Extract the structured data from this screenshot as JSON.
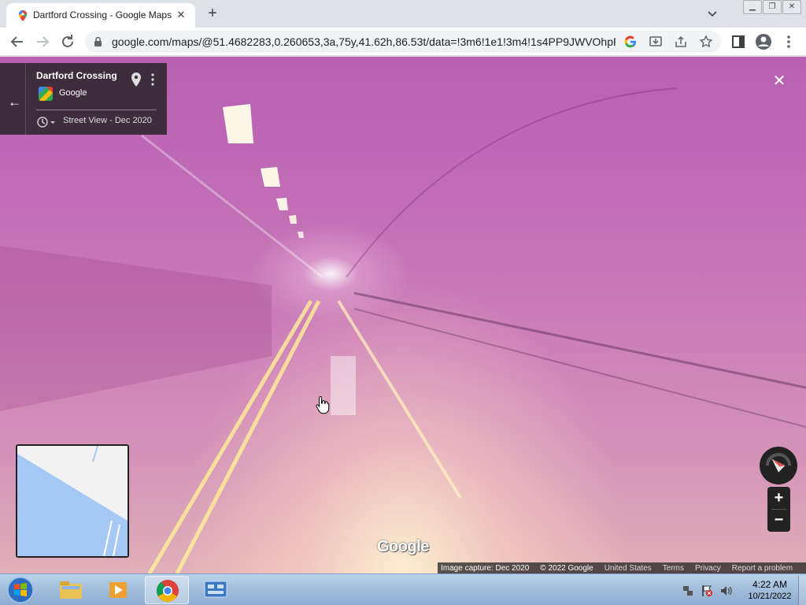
{
  "browser": {
    "tab": {
      "title": "Dartford Crossing - Google Maps",
      "favicon": "google-maps-pin-icon",
      "close_label": "✕"
    },
    "new_tab_label": "+",
    "url": "google.com/maps/@51.4682283,0.260653,3a,75y,41.62h,86.53t/data=!3m6!1e1!3m4!1s4PP9JWVOhpP...",
    "icons": [
      "back-arrow-icon",
      "forward-arrow-icon",
      "reload-icon",
      "lock-icon",
      "google-icon",
      "install-icon",
      "share-icon",
      "bookmark-star-icon",
      "side-panel-icon",
      "profile-icon",
      "more-menu-icon"
    ]
  },
  "streetview": {
    "panel": {
      "title": "Dartford Crossing",
      "source": "Google",
      "date_label": "Street View - Dec 2020"
    },
    "watermark": "Google",
    "footer": {
      "capture": "Image capture: Dec 2020",
      "copyright": "© 2022 Google",
      "region": "United States",
      "terms": "Terms",
      "privacy": "Privacy",
      "report": "Report a problem"
    },
    "zoom_in_label": "+",
    "zoom_out_label": "−",
    "close_label": "✕",
    "back_label": "←",
    "colors": {
      "panel_bg": "#222222",
      "map_water": "#a6c8f5",
      "map_land": "#f2f2f2"
    }
  },
  "taskbar": {
    "clock_time": "4:22 AM",
    "clock_date": "10/21/2022",
    "pinned": [
      "file-explorer-icon",
      "media-player-icon",
      "chrome-icon",
      "control-panel-icon"
    ]
  }
}
